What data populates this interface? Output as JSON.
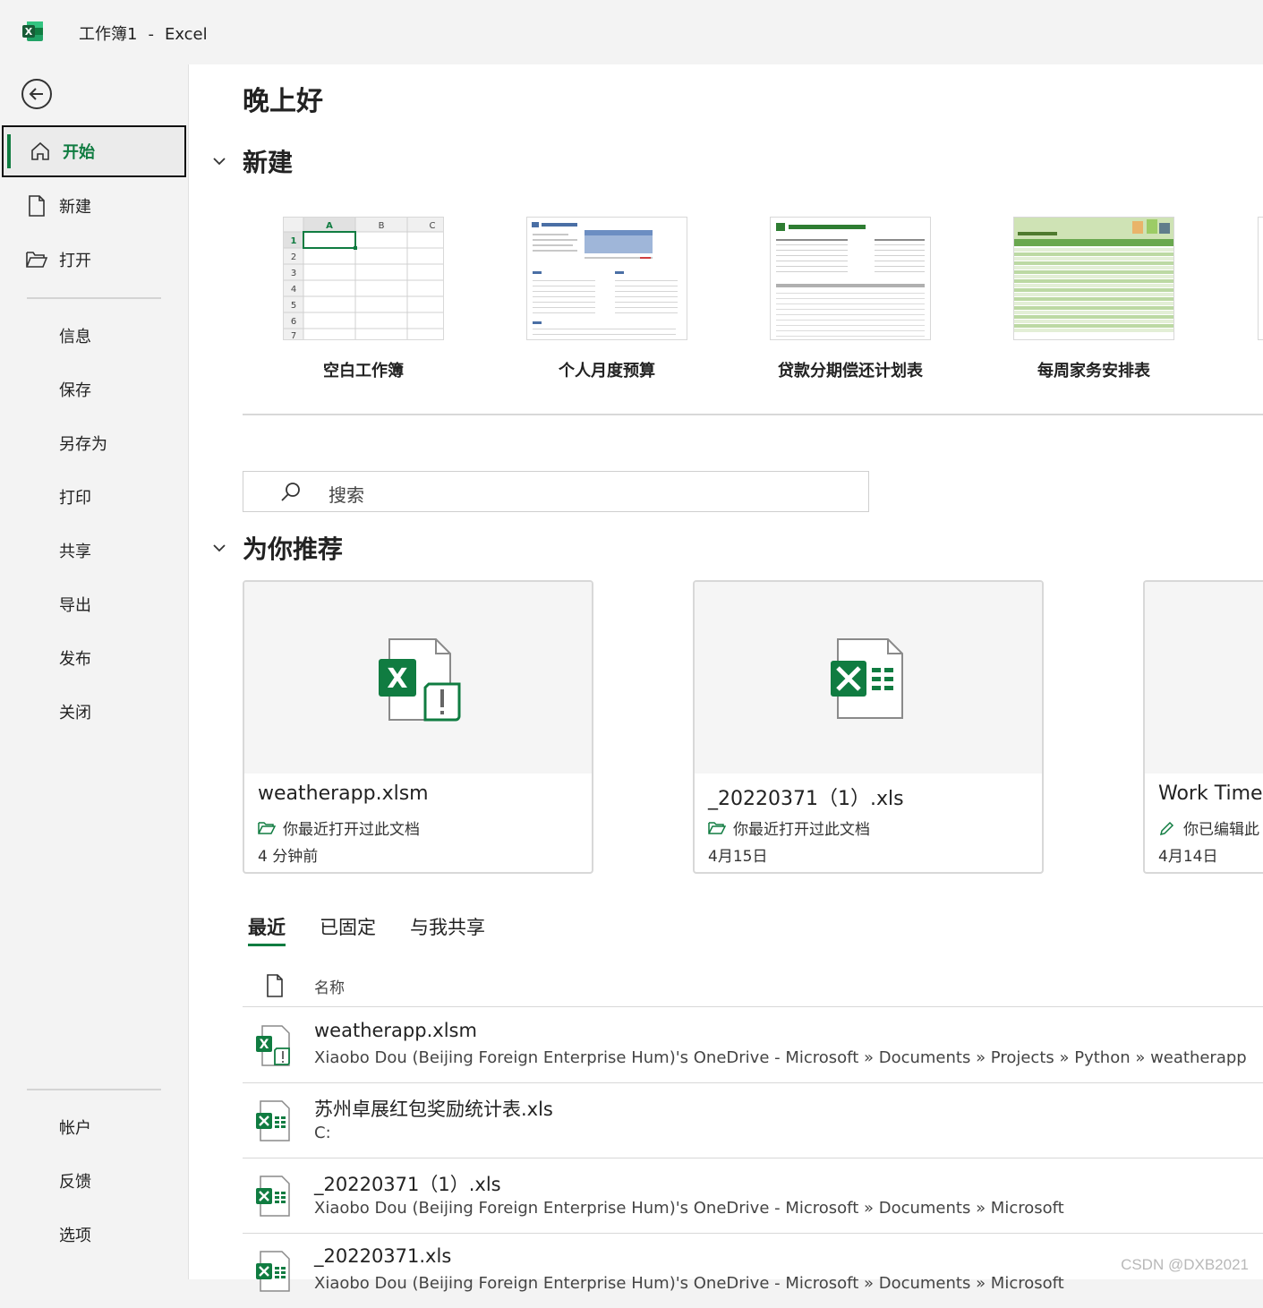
{
  "titlebar": {
    "doc_name": "工作簿1",
    "separator": "-",
    "app_name": "Excel"
  },
  "sidebar": {
    "items": [
      {
        "label": "开始",
        "icon": "home-icon",
        "active": true
      },
      {
        "label": "新建",
        "icon": "new-document-icon"
      },
      {
        "label": "打开",
        "icon": "folder-open-icon"
      }
    ],
    "sub_items": [
      "信息",
      "保存",
      "另存为",
      "打印",
      "共享",
      "导出",
      "发布",
      "关闭"
    ],
    "bottom_items": [
      "帐户",
      "反馈",
      "选项"
    ]
  },
  "main": {
    "greeting": "晚上好",
    "new_section": {
      "title": "新建",
      "templates": [
        {
          "label": "空白工作簿"
        },
        {
          "label": "个人月度预算"
        },
        {
          "label": "贷款分期偿还计划表"
        },
        {
          "label": "每周家务安排表"
        }
      ],
      "blank_grid": {
        "cols": [
          "A",
          "B",
          "C"
        ],
        "rows": [
          "1",
          "2",
          "3",
          "4",
          "5",
          "6",
          "7"
        ]
      }
    },
    "search": {
      "placeholder": "搜索"
    },
    "recommended": {
      "title": "为你推荐",
      "cards": [
        {
          "name": "weatherapp.xlsm",
          "meta": "你最近打开过此文档",
          "date": "4 分钟前",
          "icon": "excel-macro-file-icon",
          "meta_icon": "folder-icon"
        },
        {
          "name": "_20220371（1）.xls",
          "meta": "你最近打开过此文档",
          "date": "4月15日",
          "icon": "excel-file-icon",
          "meta_icon": "folder-icon"
        },
        {
          "name": "Work Time",
          "meta": "你已编辑此",
          "date": "4月14日",
          "icon": "excel-file-icon",
          "meta_icon": "pencil-icon"
        }
      ]
    },
    "tabs": [
      {
        "label": "最近",
        "active": true
      },
      {
        "label": "已固定"
      },
      {
        "label": "与我共享"
      }
    ],
    "list": {
      "header_name": "名称",
      "rows": [
        {
          "name": "weatherapp.xlsm",
          "path": "Xiaobo Dou (Beijing Foreign Enterprise Hum)'s OneDrive - Microsoft » Documents » Projects » Python » weatherapp",
          "icon": "excel-macro-file-icon"
        },
        {
          "name": "苏州卓展红包奖励统计表.xls",
          "path": "C:",
          "icon": "excel-file-icon"
        },
        {
          "name": "_20220371（1）.xls",
          "path": "Xiaobo Dou (Beijing Foreign Enterprise Hum)'s OneDrive - Microsoft » Documents » Microsoft",
          "icon": "excel-file-icon"
        },
        {
          "name": "_20220371.xls",
          "path": "Xiaobo Dou (Beijing Foreign Enterprise Hum)'s OneDrive - Microsoft » Documents » Microsoft",
          "icon": "excel-file-icon"
        }
      ]
    }
  },
  "watermark": "CSDN @DXB2021",
  "colors": {
    "accent": "#107c41",
    "background": "#f3f3f3"
  }
}
